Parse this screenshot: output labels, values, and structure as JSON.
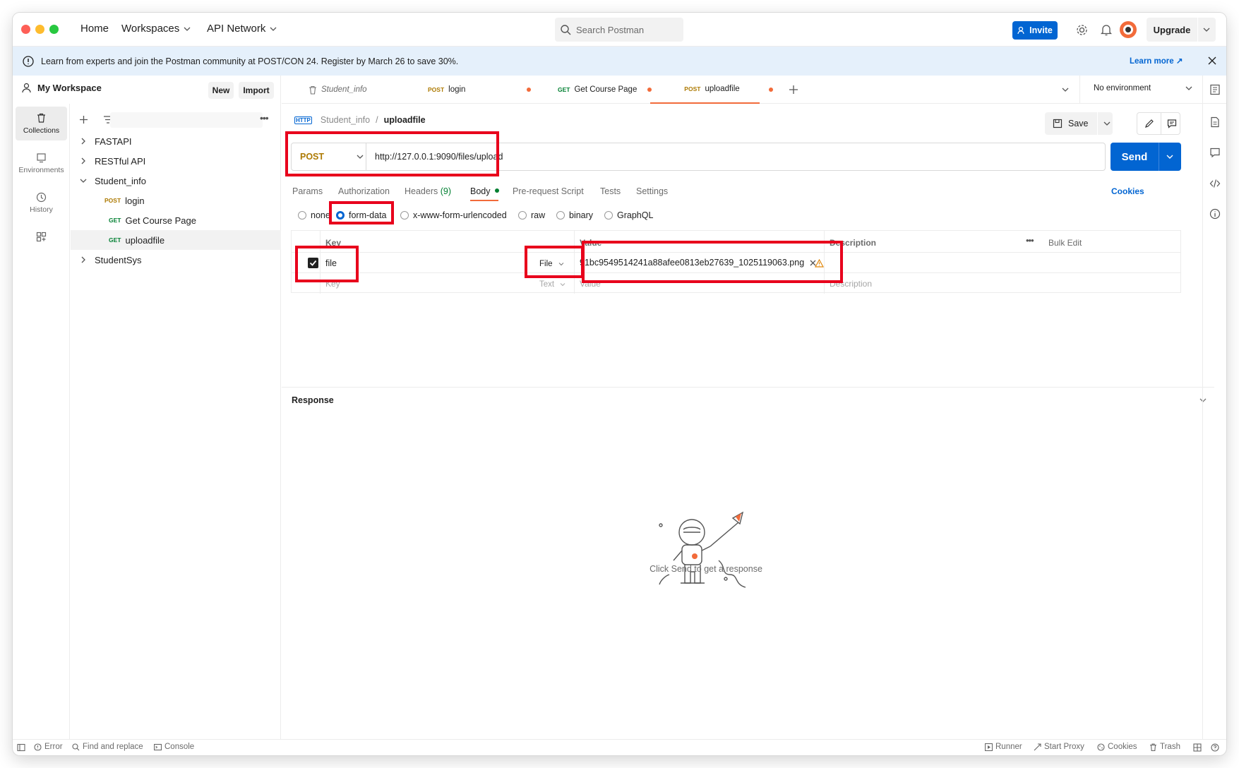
{
  "titlebar": {
    "nav": [
      "Home",
      "Workspaces",
      "API Network"
    ],
    "search_placeholder": "Search Postman",
    "invite_label": "Invite",
    "upgrade_label": "Upgrade"
  },
  "banner": {
    "text": "Learn from experts and join the Postman community at POST/CON 24. Register by March 26 to save 30%.",
    "link": "Learn more ↗"
  },
  "sidebar": {
    "workspace": "My Workspace",
    "new_label": "New",
    "import_label": "Import",
    "rail": [
      "Collections",
      "Environments",
      "History"
    ],
    "tree": [
      {
        "label": "FASTAPI"
      },
      {
        "label": "RESTful API"
      },
      {
        "label": "Student_info"
      },
      {
        "method": "POST",
        "label": "login"
      },
      {
        "method": "GET",
        "label": "Get Course Page"
      },
      {
        "method": "GET",
        "label": "uploadfile"
      },
      {
        "label": "StudentSys"
      }
    ]
  },
  "tabs": [
    {
      "label": "Student_info"
    },
    {
      "method": "POST",
      "label": "login"
    },
    {
      "method": "GET",
      "label": "Get Course Page"
    },
    {
      "method": "POST",
      "label": "uploadfile"
    }
  ],
  "environment": "No environment",
  "request": {
    "breadcrumb_parent": "Student_info",
    "breadcrumb_sep": "/",
    "breadcrumb_current": "uploadfile",
    "save_label": "Save",
    "method": "POST",
    "url": "http://127.0.0.1:9090/files/upload",
    "send_label": "Send",
    "subtabs": [
      "Params",
      "Authorization",
      "Headers",
      "Body",
      "Pre-request Script",
      "Tests",
      "Settings"
    ],
    "headers_count": "(9)",
    "cookies_label": "Cookies",
    "body_types": [
      "none",
      "form-data",
      "x-www-form-urlencoded",
      "raw",
      "binary",
      "GraphQL"
    ],
    "table": {
      "columns": [
        "Key",
        "Value",
        "Description"
      ],
      "bulk_edit": "Bulk Edit",
      "row": {
        "key": "file",
        "type": "File",
        "value": "91bc9549514241a88afee0813eb27639_1025119063.png"
      },
      "empty": {
        "key": "Key",
        "type": "Text",
        "value": "Value",
        "description": "Description"
      }
    }
  },
  "response": {
    "title": "Response",
    "hint": "Click Send to get a response"
  },
  "statusbar": {
    "left": [
      "Error",
      "Find and replace",
      "Console"
    ],
    "right": [
      "Runner",
      "Start Proxy",
      "Cookies",
      "Trash"
    ]
  },
  "colors": {
    "accent": "#0265d2",
    "highlight": "#e8001c",
    "post": "#ad7a03",
    "get": "#007f31",
    "unsaved_dot": "#f26b3a"
  }
}
